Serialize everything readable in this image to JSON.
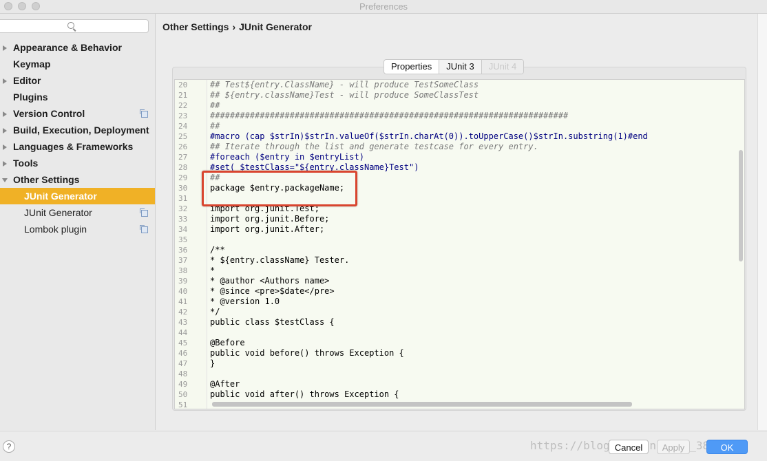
{
  "window": {
    "title": "Preferences"
  },
  "sidebar": {
    "search_placeholder": "",
    "items": [
      {
        "label": "Appearance & Behavior",
        "expandable": true
      },
      {
        "label": "Keymap",
        "expandable": false
      },
      {
        "label": "Editor",
        "expandable": true
      },
      {
        "label": "Plugins",
        "expandable": false
      },
      {
        "label": "Version Control",
        "expandable": true,
        "project_icon": true
      },
      {
        "label": "Build, Execution, Deployment",
        "expandable": true
      },
      {
        "label": "Languages & Frameworks",
        "expandable": true
      },
      {
        "label": "Tools",
        "expandable": true
      },
      {
        "label": "Other Settings",
        "expanded": true
      },
      {
        "label": "JUnit Generator",
        "selected": true
      },
      {
        "label": "JUnit Generator",
        "project_icon": true
      },
      {
        "label": "Lombok plugin",
        "project_icon": true
      }
    ]
  },
  "breadcrumb": {
    "parent": "Other Settings",
    "separator": "›",
    "current": "JUnit Generator"
  },
  "tabs": [
    {
      "label": "Properties"
    },
    {
      "label": "JUnit 3",
      "active": true
    },
    {
      "label": "JUnit 4",
      "disabled": true
    }
  ],
  "editor": {
    "lines": [
      {
        "n": "20",
        "text": "## Test${entry.ClassName} - will produce TestSomeClass",
        "kind": "comment"
      },
      {
        "n": "21",
        "text": "## ${entry.className}Test - will produce SomeClassTest",
        "kind": "comment"
      },
      {
        "n": "22",
        "text": "##",
        "kind": "comment"
      },
      {
        "n": "23",
        "text": "########################################################################",
        "kind": "comment"
      },
      {
        "n": "24",
        "text": "##",
        "kind": "comment"
      },
      {
        "n": "25",
        "text": "#macro (cap $strIn)$strIn.valueOf($strIn.charAt(0)).toUpperCase()$strIn.substring(1)#end",
        "kind": "directive"
      },
      {
        "n": "26",
        "text": "## Iterate through the list and generate testcase for every entry.",
        "kind": "comment"
      },
      {
        "n": "27",
        "text": "#foreach ($entry in $entryList)",
        "kind": "directive"
      },
      {
        "n": "28",
        "text": "#set( $testClass=\"${entry.className}Test\")",
        "kind": "directive"
      },
      {
        "n": "29",
        "text": "##",
        "kind": "comment"
      },
      {
        "n": "30",
        "text": "package $entry.packageName;",
        "kind": "code"
      },
      {
        "n": "31",
        "text": "",
        "kind": "code"
      },
      {
        "n": "32",
        "text": "import org.junit.Test;",
        "kind": "code"
      },
      {
        "n": "33",
        "text": "import org.junit.Before;",
        "kind": "code"
      },
      {
        "n": "34",
        "text": "import org.junit.After;",
        "kind": "code"
      },
      {
        "n": "35",
        "text": "",
        "kind": "code"
      },
      {
        "n": "36",
        "text": "/**",
        "kind": "code"
      },
      {
        "n": "37",
        "text": "* ${entry.className} Tester.",
        "kind": "code"
      },
      {
        "n": "38",
        "text": "*",
        "kind": "code"
      },
      {
        "n": "39",
        "text": "* @author <Authors name>",
        "kind": "code"
      },
      {
        "n": "40",
        "text": "* @since <pre>$date</pre>",
        "kind": "code"
      },
      {
        "n": "41",
        "text": "* @version 1.0",
        "kind": "code"
      },
      {
        "n": "42",
        "text": "*/",
        "kind": "code"
      },
      {
        "n": "43",
        "text": "public class $testClass {",
        "kind": "code"
      },
      {
        "n": "44",
        "text": "",
        "kind": "code"
      },
      {
        "n": "45",
        "text": "@Before",
        "kind": "code"
      },
      {
        "n": "46",
        "text": "public void before() throws Exception {",
        "kind": "code"
      },
      {
        "n": "47",
        "text": "}",
        "kind": "code"
      },
      {
        "n": "48",
        "text": "",
        "kind": "code"
      },
      {
        "n": "49",
        "text": "@After",
        "kind": "code"
      },
      {
        "n": "50",
        "text": "public void after() throws Exception {",
        "kind": "code"
      },
      {
        "n": "51",
        "text": "",
        "kind": "code"
      }
    ]
  },
  "footer": {
    "help_label": "?",
    "cancel_label": "Cancel",
    "apply_label": "Apply",
    "ok_label": "OK",
    "watermark": "https://blog.csdn.net/qq_38?0?66"
  },
  "colors": {
    "selection": "#f0b126",
    "highlight_box": "#d9452f",
    "ok_button": "#4f9af6"
  }
}
